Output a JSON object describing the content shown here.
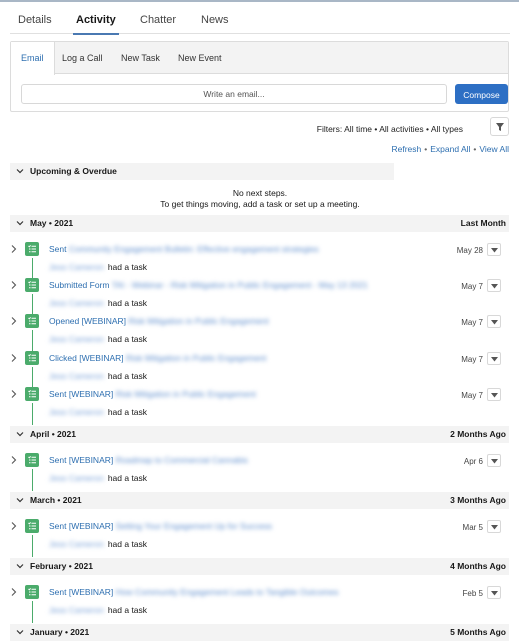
{
  "record_tabs": [
    {
      "label": "Details",
      "active": false
    },
    {
      "label": "Activity",
      "active": true
    },
    {
      "label": "Chatter",
      "active": false
    },
    {
      "label": "News",
      "active": false
    }
  ],
  "composer": {
    "tabs": [
      {
        "label": "Email",
        "active": true
      },
      {
        "label": "Log a Call",
        "active": false
      },
      {
        "label": "New Task",
        "active": false
      },
      {
        "label": "New Event",
        "active": false
      }
    ],
    "email_placeholder": "Write an email...",
    "compose_label": "Compose"
  },
  "filters": {
    "label": "Filters: All time • All activities • All types",
    "icon": "filter-icon"
  },
  "links": {
    "refresh": "Refresh",
    "expand_all": "Expand All",
    "view_all": "View All",
    "separator": "•"
  },
  "upcoming": {
    "title": "Upcoming & Overdue",
    "empty_line1": "No next steps.",
    "empty_line2": "To get things moving, add a task or set up a meeting."
  },
  "groups": [
    {
      "title": "May • 2021",
      "relative": "Last Month",
      "items": [
        {
          "action": "Sent",
          "subject": "Community Engagement Bulletin: Effective engagement strategies",
          "who": "Jess Cameron",
          "suffix": "had a task",
          "date": "May 28"
        },
        {
          "action": "Submitted Form",
          "subject": "TAI - Webinar - Risk Mitigation in Public Engagement - May 13 2021",
          "who": "Jess Cameron",
          "suffix": "had a task",
          "date": "May 7"
        },
        {
          "action": "Opened [WEBINAR]",
          "subject": "Risk Mitigation in Public Engagement",
          "who": "Jess Cameron",
          "suffix": "had a task",
          "date": "May 7"
        },
        {
          "action": "Clicked [WEBINAR]",
          "subject": "Risk Mitigation in Public Engagement",
          "who": "Jess Cameron",
          "suffix": "had a task",
          "date": "May 7"
        },
        {
          "action": "Sent [WEBINAR]",
          "subject": "Risk Mitigation in Public Engagement",
          "who": "Jess Cameron",
          "suffix": "had a task",
          "date": "May 7"
        }
      ]
    },
    {
      "title": "April • 2021",
      "relative": "2 Months Ago",
      "items": [
        {
          "action": "Sent [WEBINAR]",
          "subject": "Roadmap to Commercial Cannabis",
          "who": "Jess Cameron",
          "suffix": "had a task",
          "date": "Apr 6"
        }
      ]
    },
    {
      "title": "March • 2021",
      "relative": "3 Months Ago",
      "items": [
        {
          "action": "Sent [WEBINAR]",
          "subject": "Setting Your Engagement Up for Success",
          "who": "Jess Cameron",
          "suffix": "had a task",
          "date": "Mar 5"
        }
      ]
    },
    {
      "title": "February • 2021",
      "relative": "4 Months Ago",
      "items": [
        {
          "action": "Sent [WEBINAR]",
          "subject": "How Community Engagement Leads to Tangible Outcomes",
          "who": "Jess Cameron",
          "suffix": "had a task",
          "date": "Feb 5"
        }
      ]
    },
    {
      "title": "January • 2021",
      "relative": "5 Months Ago",
      "items": []
    }
  ],
  "colors": {
    "link": "#2e6fb0",
    "compose_button": "#2d6fc4",
    "task_icon": "#4bab6b",
    "group_header_bg": "#f3f3f3"
  }
}
